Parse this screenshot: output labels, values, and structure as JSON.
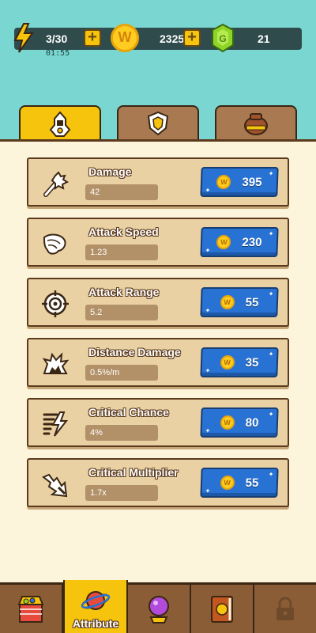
{
  "resources": {
    "energy": "3/30",
    "timer": "01:55",
    "coins": "2325",
    "gems": "21",
    "coin_glyph": "W"
  },
  "tabs": [
    {
      "name": "hero",
      "icon": "hero-icon",
      "active": true
    },
    {
      "name": "shield",
      "icon": "shield-icon",
      "active": false
    },
    {
      "name": "bag",
      "icon": "bag-icon",
      "active": false
    }
  ],
  "attributes": [
    {
      "title": "Damage",
      "value": "42",
      "cost": "395",
      "icon": "club-icon"
    },
    {
      "title": "Attack Speed",
      "value": "1.23",
      "cost": "230",
      "icon": "wing-icon"
    },
    {
      "title": "Attack Range",
      "value": "5.2",
      "cost": "55",
      "icon": "crosshair-icon"
    },
    {
      "title": "Distance Damage",
      "value": "0.5%/m",
      "cost": "35",
      "icon": "explosion-icon"
    },
    {
      "title": "Critical Chance",
      "value": "4%",
      "cost": "80",
      "icon": "lightning-icon"
    },
    {
      "title": "Critical Multiplier",
      "value": "1.7x",
      "cost": "55",
      "icon": "crit-arrow-icon"
    }
  ],
  "nav": {
    "active_label": "Attribute",
    "items": [
      "shop-icon",
      "planet-icon",
      "crystal-ball-icon",
      "book-icon",
      "lock-icon"
    ]
  },
  "colors": {
    "sky": "#79d6d0",
    "accent": "#f6c30d",
    "button": "#2872d4",
    "panel": "#fdf4dc",
    "card": "#ead1a4"
  }
}
